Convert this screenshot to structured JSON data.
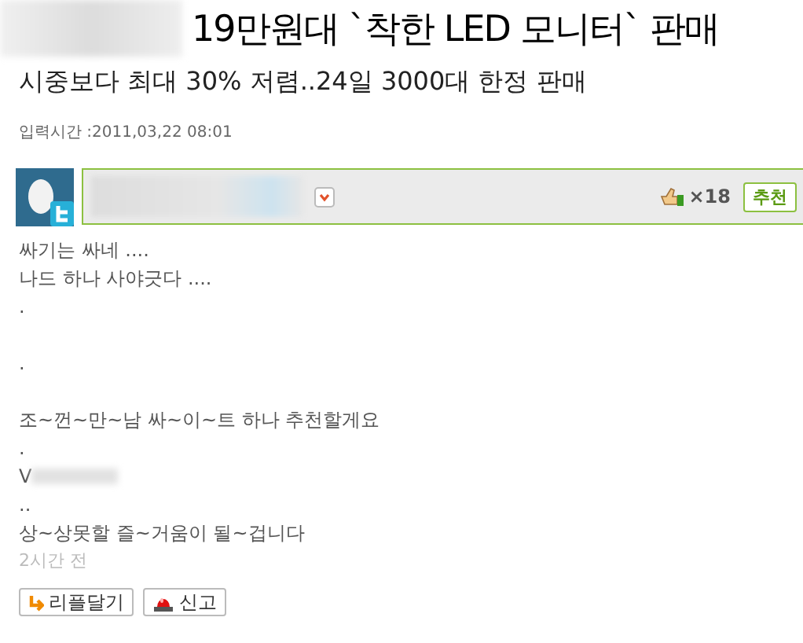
{
  "article": {
    "title": "19만원대 `착한 LED 모니터` 판매",
    "subtitle": "시중보다 최대 30% 저렴..24일 3000대 한정 판매",
    "date": "입력시간 :2011,03,22 08:01"
  },
  "comment": {
    "like_count": "×18",
    "recommend_button": "추천",
    "lines": [
      {
        "kind": "text",
        "text": "싸기는 싸네 ...."
      },
      {
        "kind": "text",
        "text": "나드 하나 사야긋다 ...."
      },
      {
        "kind": "text",
        "text": "."
      },
      {
        "kind": "blank"
      },
      {
        "kind": "text",
        "text": "."
      },
      {
        "kind": "blank"
      },
      {
        "kind": "text",
        "text": "조~껀~만~남  싸~이~트 하나 추천할게요"
      },
      {
        "kind": "text",
        "text": "."
      },
      {
        "kind": "redacted",
        "text": "V"
      },
      {
        "kind": "text",
        "text": ".."
      },
      {
        "kind": "text",
        "text": "상~상못할 즐~거움이 될~겁니다"
      }
    ],
    "time": "2시간 전",
    "buttons": [
      {
        "kind": "reply",
        "label": "리플달기"
      },
      {
        "kind": "report",
        "label": "신고"
      }
    ]
  }
}
